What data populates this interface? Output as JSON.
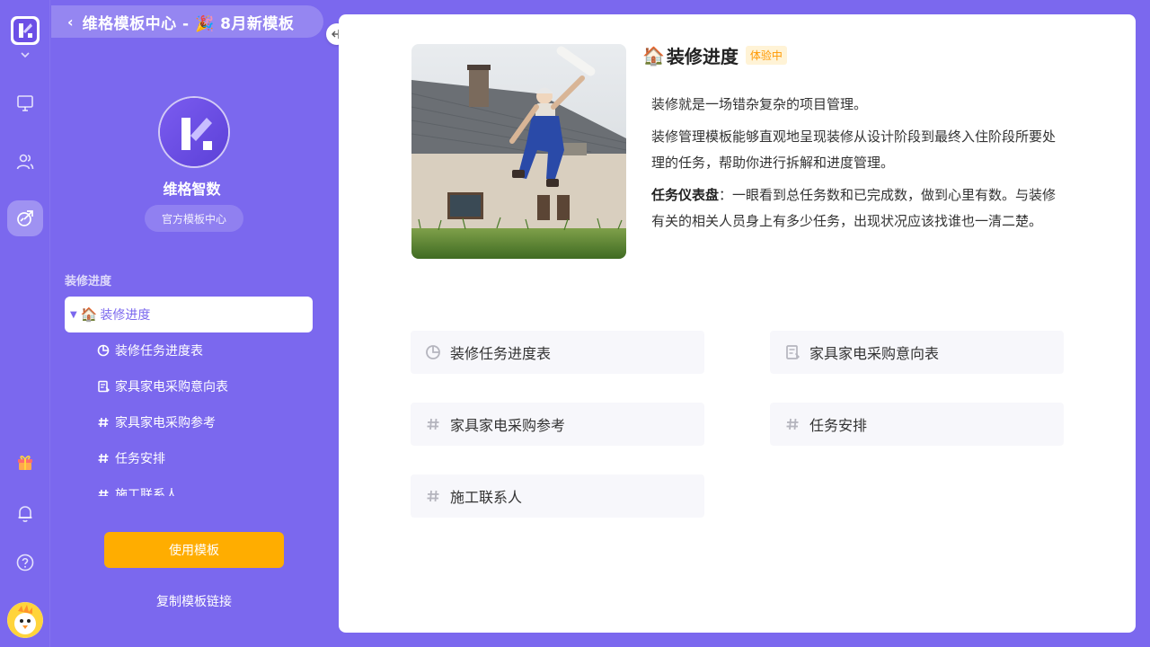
{
  "header": {
    "back_icon": "chevron-left-icon",
    "title": "维格模板中心 - 🎉 8月新模板"
  },
  "brand": {
    "name": "维格智数",
    "tag": "官方模板中心"
  },
  "tree": {
    "section_label": "装修进度",
    "root": {
      "emoji": "🏠",
      "label": "装修进度"
    },
    "items": [
      {
        "icon": "dashboard-icon",
        "label": "装修任务进度表"
      },
      {
        "icon": "form-icon",
        "label": "家具家电采购意向表"
      },
      {
        "icon": "grid-icon",
        "label": "家具家电采购参考"
      },
      {
        "icon": "grid-icon",
        "label": "任务安排"
      },
      {
        "icon": "grid-icon",
        "label": "施工联系人"
      }
    ]
  },
  "actions": {
    "use_template": "使用模板",
    "copy_link": "复制模板链接"
  },
  "template": {
    "emoji": "🏠",
    "title": "装修进度",
    "badge": "体验中",
    "desc_1": "装修就是一场错杂复杂的项目管理。",
    "desc_2": "装修管理模板能够直观地呈现装修从设计阶段到最终入住阶段所要处理的任务，帮助你进行拆解和进度管理。",
    "desc_3_label": "任务仪表盘",
    "desc_3": "：一眼看到总任务数和已完成数，做到心里有数。与装修有关的相关人员身上有多少任务，出现状况应该找谁也一清二楚。"
  },
  "cards": [
    {
      "icon": "dashboard-icon",
      "label": "装修任务进度表"
    },
    {
      "icon": "form-icon",
      "label": "家具家电采购意向表"
    },
    {
      "icon": "grid-icon",
      "label": "家具家电采购参考"
    },
    {
      "icon": "grid-icon",
      "label": "任务安排"
    },
    {
      "icon": "grid-icon",
      "label": "施工联系人"
    }
  ],
  "colors": {
    "brand": "#7b68ee",
    "accent": "#ffad00",
    "badge_text": "#ff9800"
  }
}
